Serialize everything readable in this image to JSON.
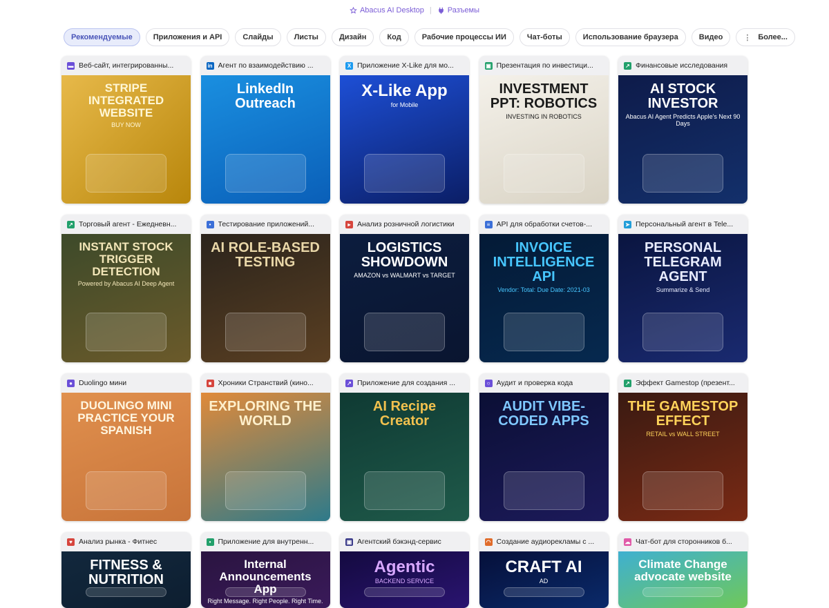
{
  "header": {
    "desktop_link": "Abacus AI Desktop",
    "separator": "|",
    "connectors_link": "Разъемы"
  },
  "tabs": [
    {
      "label": "Рекомендуемые",
      "active": true
    },
    {
      "label": "Приложения и API"
    },
    {
      "label": "Слайды"
    },
    {
      "label": "Листы"
    },
    {
      "label": "Дизайн"
    },
    {
      "label": "Код"
    },
    {
      "label": "Рабочие процессы ИИ"
    },
    {
      "label": "Чат-боты"
    },
    {
      "label": "Использование браузера"
    },
    {
      "label": "Видео"
    },
    {
      "label": "Более..."
    }
  ],
  "cards": [
    {
      "title": "Веб-сайт, интегрированны...",
      "icon": "card-icon",
      "icon_color": "#6b4fd8",
      "thumb_title": "STRIPE INTEGRATED WEBSITE",
      "thumb_sub": "BUY NOW",
      "bg": "linear-gradient(135deg,#e7b94a,#b8860b)",
      "fg": "#fff7d6"
    },
    {
      "title": "Агент по взаимодействию ...",
      "icon": "linkedin-icon",
      "icon_color": "#0a66c2",
      "thumb_title": "LinkedIn Outreach",
      "thumb_sub": "",
      "bg": "linear-gradient(160deg,#1a8fe0,#0a5fb8)",
      "fg": "#ffffff"
    },
    {
      "title": "Приложение X-Like для мо...",
      "icon": "x-icon",
      "icon_color": "#1d9bf0",
      "thumb_title": "X-Like App",
      "thumb_sub": "for Mobile",
      "bg": "linear-gradient(160deg,#1d4fd6,#0b1e66)",
      "fg": "#ffffff"
    },
    {
      "title": "Презентация по инвестици...",
      "icon": "robot-icon",
      "icon_color": "#22a06b",
      "thumb_title": "INVESTMENT PPT: ROBOTICS",
      "thumb_sub": "INVESTING IN ROBOTICS",
      "bg": "linear-gradient(160deg,#f4f1ea,#d9d3c4)",
      "fg": "#1a1a1a"
    },
    {
      "title": "Финансовые исследования",
      "icon": "chart-icon",
      "icon_color": "#22a06b",
      "thumb_title": "AI STOCK INVESTOR",
      "thumb_sub": "Abacus AI Agent Predicts Apple's Next 90 Days",
      "bg": "linear-gradient(160deg,#0e1b4a,#13306b)",
      "fg": "#ffffff"
    },
    {
      "title": "Торговый агент - Ежедневн...",
      "icon": "chart-icon",
      "icon_color": "#22a06b",
      "thumb_title": "INSTANT STOCK TRIGGER DETECTION",
      "thumb_sub": "Powered by Abacus AI Deep Agent",
      "bg": "linear-gradient(160deg,#3d4a2a,#6b5a2a)",
      "fg": "#f3e6b8"
    },
    {
      "title": "Тестирование приложений...",
      "icon": "people-icon",
      "icon_color": "#3b6fd8",
      "thumb_title": "AI ROLE-BASED TESTING",
      "thumb_sub": "",
      "bg": "linear-gradient(160deg,#2b241c,#5a3f22)",
      "fg": "#e9d7a8"
    },
    {
      "title": "Анализ розничной логистики",
      "icon": "truck-icon",
      "icon_color": "#d6453d",
      "thumb_title": "LOGISTICS SHOWDOWN",
      "thumb_sub": "AMAZON vs WALMART vs TARGET",
      "bg": "linear-gradient(160deg,#0c1d3e,#0a1530)",
      "fg": "#ffffff"
    },
    {
      "title": "API для обработки счетов-...",
      "icon": "doc-icon",
      "icon_color": "#3b6fd8",
      "thumb_title": "INVOICE INTELLIGENCE API",
      "thumb_sub": "Vendor: Total: Due Date: 2021-03",
      "bg": "linear-gradient(160deg,#041a36,#06294f)",
      "fg": "#47c6ff"
    },
    {
      "title": "Персональный агент в Tele...",
      "icon": "telegram-icon",
      "icon_color": "#229ed9",
      "thumb_title": "PERSONAL TELEGRAM AGENT",
      "thumb_sub": "Summarize & Send",
      "bg": "linear-gradient(160deg,#0a1540,#1a2a70)",
      "fg": "#e8ecff"
    },
    {
      "title": "Duolingo мини",
      "icon": "globe-icon",
      "icon_color": "#6b4fd8",
      "thumb_title": "DUOLINGO MINI PRACTICE YOUR SPANISH",
      "thumb_sub": "",
      "bg": "linear-gradient(160deg,#e0904e,#c8743a)",
      "fg": "#fff6e0"
    },
    {
      "title": "Хроники Странствий (кино...",
      "icon": "book-icon",
      "icon_color": "#d6453d",
      "thumb_title": "EXPLORING THE WORLD",
      "thumb_sub": "",
      "bg": "linear-gradient(160deg,#e08a3a,#2e7a8a)",
      "fg": "#fff0cc"
    },
    {
      "title": "Приложение для создания ...",
      "icon": "chart-icon",
      "icon_color": "#6b4fd8",
      "thumb_title": "AI Recipe Creator",
      "thumb_sub": "",
      "bg": "linear-gradient(160deg,#0f3a33,#1f5a4a)",
      "fg": "#f2c14e"
    },
    {
      "title": "Аудит и проверка кода",
      "icon": "search-icon",
      "icon_color": "#6b4fd8",
      "thumb_title": "AUDIT VIBE-CODED APPS",
      "thumb_sub": "",
      "bg": "linear-gradient(160deg,#0b0f35,#1c1a5a)",
      "fg": "#7fc8ff"
    },
    {
      "title": "Эффект Gamestop (презент...",
      "icon": "chart-icon",
      "icon_color": "#22a06b",
      "thumb_title": "THE GAMESTOP EFFECT",
      "thumb_sub": "RETAIL vs WALL STREET",
      "bg": "linear-gradient(160deg,#3a1a12,#7a2a14)",
      "fg": "#ffd35a"
    },
    {
      "title": "Анализ рынка - Фитнес",
      "icon": "heart-icon",
      "icon_color": "#d6453d",
      "thumb_title": "FITNESS & NUTRITION",
      "thumb_sub": "",
      "bg": "linear-gradient(160deg,#12283d,#0d1e30)",
      "fg": "#ffffff"
    },
    {
      "title": "Приложение для внутренн...",
      "icon": "people-icon",
      "icon_color": "#22a06b",
      "thumb_title": "Internal Announcements App",
      "thumb_sub": "Right Message. Right People. Right Time.",
      "bg": "linear-gradient(160deg,#2a1440,#3a1a5a)",
      "fg": "#ffffff"
    },
    {
      "title": "Агентский бэкэнд-сервис",
      "icon": "robot-icon",
      "icon_color": "#3b3b8a",
      "thumb_title": "Agentic",
      "thumb_sub": "BACKEND SERVICE",
      "bg": "linear-gradient(160deg,#140a40,#2a1470)",
      "fg": "#d8a8ff"
    },
    {
      "title": "Создание аудиорекламы с ...",
      "icon": "headset-icon",
      "icon_color": "#e06b2a",
      "thumb_title": "CRAFT AI",
      "thumb_sub": "AD",
      "bg": "linear-gradient(160deg,#06103a,#0a2a6a)",
      "fg": "#ffffff"
    },
    {
      "title": "Чат-бот для сторонников б...",
      "icon": "cloud-icon",
      "icon_color": "#e05aa8",
      "thumb_title": "Climate Change advocate website",
      "thumb_sub": "",
      "bg": "linear-gradient(160deg,#3fb0d0,#6fc85a)",
      "fg": "#ffffff"
    }
  ]
}
